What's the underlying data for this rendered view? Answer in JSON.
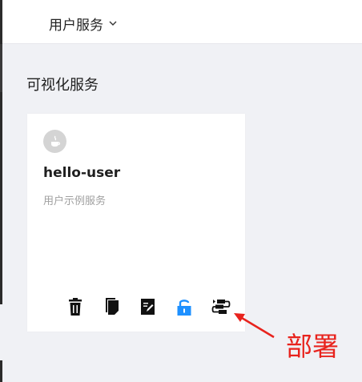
{
  "header": {
    "service_selector": "用户服务"
  },
  "section": {
    "title": "可视化服务"
  },
  "card": {
    "name": "hello-user",
    "description": "用户示例服务",
    "icon": "java-icon",
    "actions": [
      {
        "name": "delete",
        "icon": "trash-icon"
      },
      {
        "name": "copy",
        "icon": "copy-icon"
      },
      {
        "name": "edit",
        "icon": "edit-icon"
      },
      {
        "name": "lock",
        "icon": "lock-icon",
        "color": "#1e90ff"
      },
      {
        "name": "deploy",
        "icon": "deploy-icon"
      }
    ]
  },
  "annotation": {
    "label": "部署",
    "color": "#e8231d"
  }
}
